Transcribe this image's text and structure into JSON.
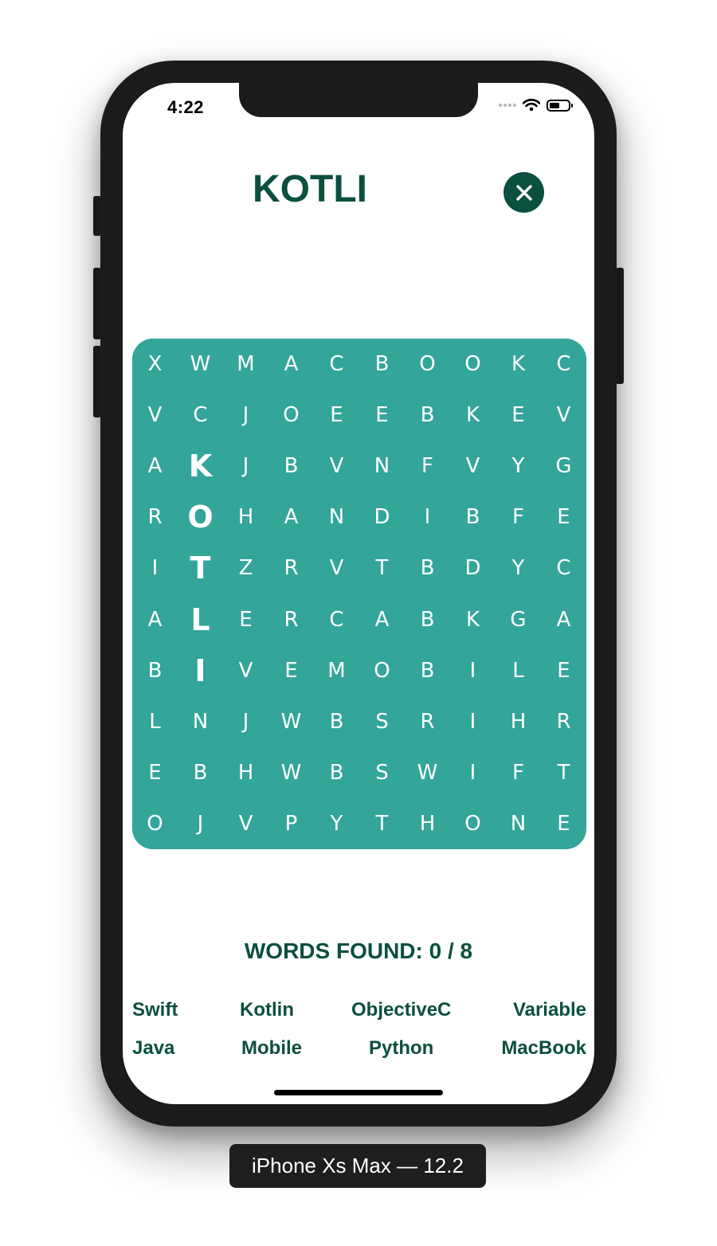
{
  "status_bar": {
    "time": "4:22",
    "icons": [
      "signal-dots-icon",
      "wifi-icon",
      "battery-icon"
    ]
  },
  "header": {
    "current_word": "KOTLI",
    "close_icon": "close-icon"
  },
  "grid": {
    "rows": [
      [
        "X",
        "W",
        "M",
        "A",
        "C",
        "B",
        "O",
        "O",
        "K",
        "C"
      ],
      [
        "V",
        "C",
        "J",
        "O",
        "E",
        "E",
        "B",
        "K",
        "E",
        "V"
      ],
      [
        "A",
        "K",
        "J",
        "B",
        "V",
        "N",
        "F",
        "V",
        "Y",
        "G"
      ],
      [
        "R",
        "O",
        "H",
        "A",
        "N",
        "D",
        "I",
        "B",
        "F",
        "E"
      ],
      [
        "I",
        "T",
        "Z",
        "R",
        "V",
        "T",
        "B",
        "D",
        "Y",
        "C"
      ],
      [
        "A",
        "L",
        "E",
        "R",
        "C",
        "A",
        "B",
        "K",
        "G",
        "A"
      ],
      [
        "B",
        "I",
        "V",
        "E",
        "M",
        "O",
        "B",
        "I",
        "L",
        "E"
      ],
      [
        "L",
        "N",
        "J",
        "W",
        "B",
        "S",
        "R",
        "I",
        "H",
        "R"
      ],
      [
        "E",
        "B",
        "H",
        "W",
        "B",
        "S",
        "W",
        "I",
        "F",
        "T"
      ],
      [
        "O",
        "J",
        "V",
        "P",
        "Y",
        "T",
        "H",
        "O",
        "N",
        "E"
      ]
    ],
    "selected_cells": [
      [
        2,
        1
      ],
      [
        3,
        1
      ],
      [
        4,
        1
      ],
      [
        5,
        1
      ],
      [
        6,
        1
      ]
    ]
  },
  "footer": {
    "found_label": "WORDS FOUND: 0 / 8",
    "words": [
      [
        "Swift",
        "Kotlin",
        "ObjectiveC",
        "Variable"
      ],
      [
        "Java",
        "Mobile",
        "Python",
        "MacBook"
      ]
    ]
  },
  "device_label": "iPhone Xs Max — 12.2",
  "colors": {
    "accent": "#0b4f3f",
    "grid_bg": "#33a599",
    "grid_text": "#ffffff",
    "frame": "#1b1b1b"
  }
}
